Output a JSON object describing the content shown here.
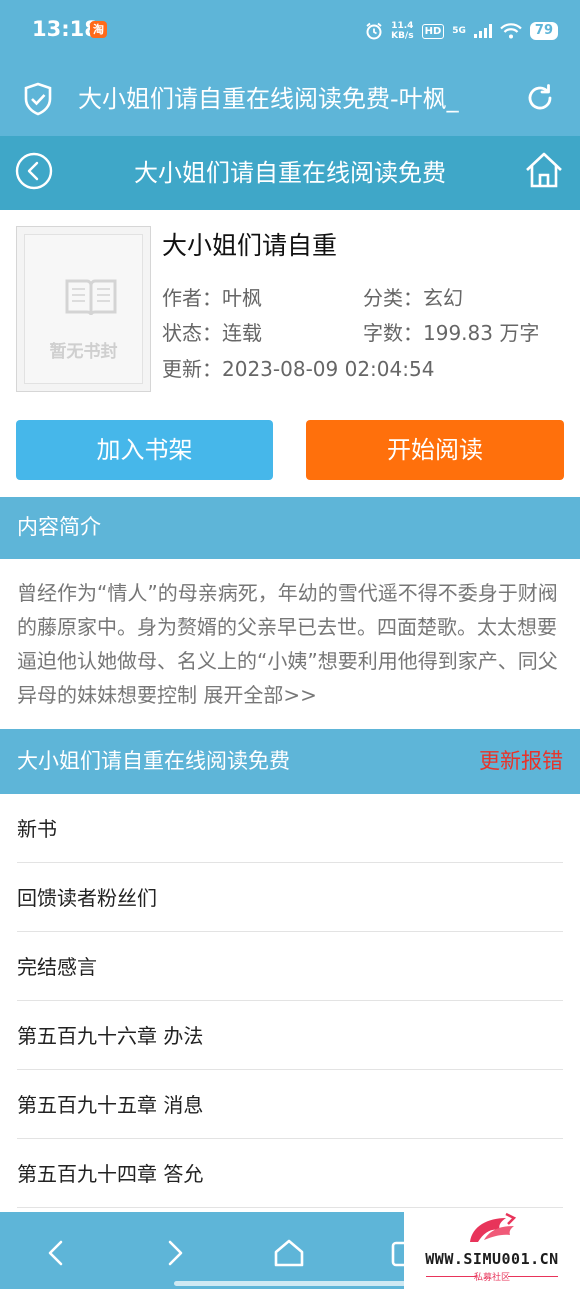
{
  "status_bar": {
    "time": "13:18",
    "app_badge": "淘",
    "net_speed_value": "11.4",
    "net_speed_unit": "KB/s",
    "hd": "HD",
    "signal": "5G",
    "battery": "79"
  },
  "browser": {
    "url_title": "大小姐们请自重在线阅读免费-叶枫_",
    "icons": [
      "shield-check-icon",
      "reload-icon"
    ]
  },
  "header": {
    "title": "大小姐们请自重在线阅读免费",
    "icons": [
      "back-circle-icon",
      "home-icon"
    ]
  },
  "book": {
    "cover_placeholder": "暂无书封",
    "title": "大小姐们请自重",
    "author_label": "作者：",
    "author": "叶枫",
    "category_label": "分类：",
    "category": "玄幻",
    "status_label": "状态：",
    "status": "连载",
    "word_count_label": "字数：",
    "word_count": "199.83 万字",
    "updated_label": "更新：",
    "updated": "2023-08-09 02:04:54"
  },
  "actions": {
    "add_shelf": "加入书架",
    "start_reading": "开始阅读"
  },
  "intro": {
    "heading": "内容简介",
    "text": "曾经作为“情人”的母亲病死，年幼的雪代遥不得不委身于财阀的藤原家中。身为赘婿的父亲早已去世。四面楚歌。太太想要逼迫他认她做母、名义上的“小姨”想要利用他得到家产、同父异母的妹妹想要控制 ",
    "expand": "展开全部>>"
  },
  "chapters": {
    "heading": "大小姐们请自重在线阅读免费",
    "report": "更新报错",
    "items": [
      "新书",
      "回馈读者粉丝们",
      "完结感言",
      "第五百九十六章 办法",
      "第五百九十五章 消息",
      "第五百九十四章 答允"
    ]
  },
  "bottom_nav": {
    "icons": [
      "back-arrow-icon",
      "forward-arrow-icon",
      "home-outline-icon",
      "tabs-icon"
    ]
  },
  "watermark": {
    "site": "WWW.SIMU001.CN",
    "subtitle": "私募社区"
  },
  "colors": {
    "bar_blue": "#5eb5d8",
    "header_blue": "#3fa7c8",
    "shelf_button": "#46b7ea",
    "read_button": "#ff700c",
    "report_red": "#e8342a"
  }
}
